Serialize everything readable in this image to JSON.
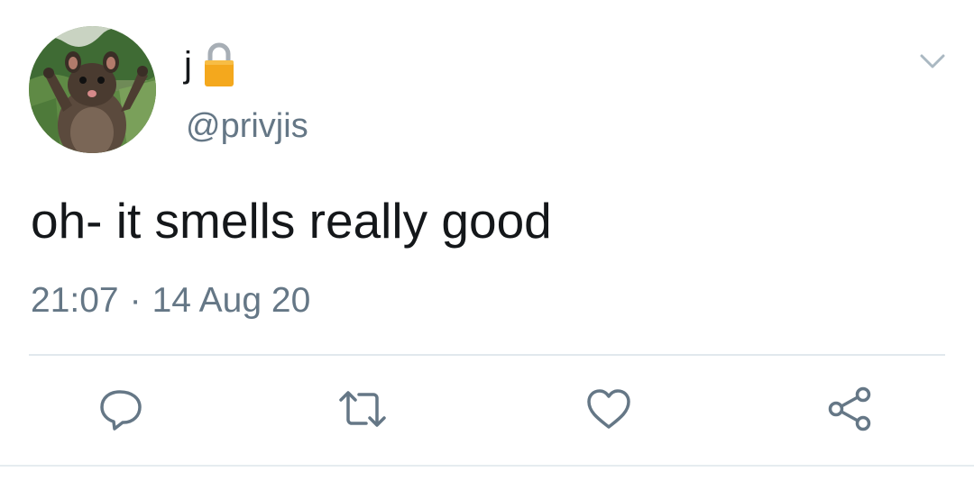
{
  "tweet": {
    "display_name": "j",
    "handle": "@privjis",
    "text": "oh- it smells really good",
    "time": "21:07",
    "separator": "·",
    "date": "14 Aug 20"
  },
  "icons": {
    "lock": "lock-icon",
    "menu": "chevron-down-icon",
    "reply": "reply-icon",
    "retweet": "retweet-icon",
    "like": "heart-icon",
    "share": "share-icon"
  },
  "colors": {
    "text": "#14171a",
    "secondary": "#657786",
    "divider": "#e1e8ed",
    "lock": "#f4a81d"
  }
}
